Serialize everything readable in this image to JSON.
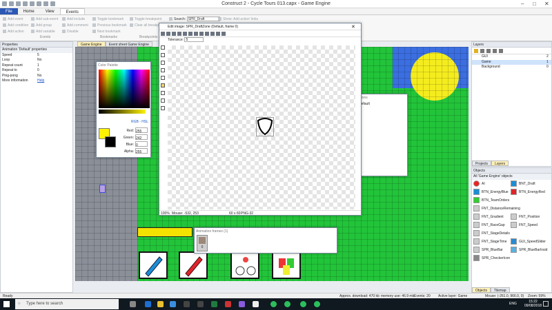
{
  "window": {
    "title": "Construct 2 - Cycle Tours 013.capx - Game Engine"
  },
  "menu": {
    "tabs": [
      "File",
      "Home",
      "View",
      "Events"
    ]
  },
  "ribbon": {
    "col1": [
      "Add event",
      "Add condition",
      "Add action"
    ],
    "col2": [
      "Add sub-event",
      "Add group",
      "Add variable"
    ],
    "col3": [
      "Add include",
      "Add comment",
      "Disable"
    ],
    "col4": [
      "Toggle bookmark",
      "Previous bookmark",
      "Next bookmark"
    ],
    "col5": [
      "Toggle breakpoint",
      "Clear all breakp..."
    ],
    "search_label": "Search:",
    "search_value": "SPR_Draft",
    "show_label": "Show: Add action' links",
    "group_events": "Events",
    "group_bookmarks": "Bookmarks",
    "group_breakpoints": "Breakpoints"
  },
  "properties": {
    "title": "Properties",
    "section": "Animation 'Default' properties",
    "rows": [
      {
        "k": "Speed",
        "v": "5"
      },
      {
        "k": "Loop",
        "v": "No"
      },
      {
        "k": "Repeat count",
        "v": "1"
      },
      {
        "k": "Repeat to",
        "v": "0"
      },
      {
        "k": "Ping-pong",
        "v": "No"
      },
      {
        "k": "More information",
        "v": "Help"
      }
    ]
  },
  "doc_tabs": [
    "Game Engine",
    "Event sheet Game Engine"
  ],
  "color_palette": {
    "title": "Color Palette",
    "rgb_hsl": "RGB - HSL",
    "fields": [
      {
        "k": "Red:",
        "v": "255"
      },
      {
        "k": "Green:",
        "v": "242"
      },
      {
        "k": "Blue:",
        "v": "0"
      },
      {
        "k": "Alpha:",
        "v": "255"
      }
    ],
    "fg_color": "#fff200",
    "bg_color": "#000000"
  },
  "image_editor": {
    "title": "Edit image: SPR_DraftZone (Default, frame 0)",
    "tolerance_label": "Tolerance:",
    "tolerance_value": "5",
    "status_zoom": "100%",
    "status_mouse": "Mouse: -532, 253",
    "status_size": "60 x 60",
    "status_format": "PNG-32"
  },
  "animations_panel": {
    "title": "Animations",
    "item": "Default"
  },
  "anim_frames": {
    "title": "Animation frames (1)",
    "frame_index": "0"
  },
  "layers": {
    "title": "Layers",
    "rows": [
      {
        "name": "GUI",
        "num": "2"
      },
      {
        "name": "Game",
        "num": "1"
      },
      {
        "name": "Background",
        "num": "0"
      }
    ],
    "tabs": [
      "Projects",
      "Layers"
    ]
  },
  "objects": {
    "title": "Objects",
    "subtitle": "All 'Game Engine' objects",
    "rows": [
      [
        "AI",
        "BNT_Draft"
      ],
      [
        "BTN_EnergyBlue",
        "BTN_EnergyRed"
      ],
      [
        "BTN_TeamOrders",
        ""
      ],
      [
        "FNT_DistanceRemaining",
        ""
      ],
      [
        "FNT_Gradient",
        "FNT_Position"
      ],
      [
        "FNT_RaceGap",
        "FNT_Speed"
      ],
      [
        "FNT_StageDetails",
        ""
      ],
      [
        "FNT_StageTime",
        "GUI_SpeedSlider"
      ],
      [
        "SPR_BlueBar",
        "SPR_BlueBarInsid"
      ],
      [
        "SPR_CheckerIcon",
        ""
      ]
    ],
    "tabs": [
      "Objects",
      "Tilemap"
    ]
  },
  "status": {
    "left": "Ready",
    "download": "Approx. download: 470 kb",
    "memory": "memory use: 46.9 mb",
    "events": "Events: 20",
    "layer": "Active layer: Game",
    "mouse": "Mouse: (-261.0, 966.0, 0)",
    "zoom": "Zoom: 59%"
  },
  "taskbar": {
    "search": "Type here to search",
    "lang": "ENG",
    "time": "15:22",
    "date": "09/08/2018"
  }
}
